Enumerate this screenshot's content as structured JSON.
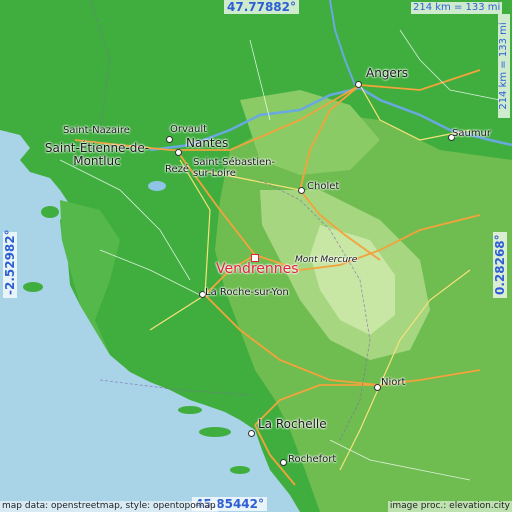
{
  "map": {
    "coordinates": {
      "top": "47.77882°",
      "bottom": "45.85442°",
      "left": "-2.52982°",
      "right": "0.28268°"
    },
    "scale": {
      "horizontal": "214 km = 133 mi",
      "vertical": "214 km = 133 mi"
    },
    "attribution": {
      "left": "map data: openstreetmap, style: opentopomap",
      "right": "image proc.: elevation.city"
    },
    "highlight_city": "Vendrennes",
    "cities": {
      "angers": "Angers",
      "saint_nazaire": "Saint-Nazaire",
      "orvault": "Orvault",
      "nantes": "Nantes",
      "saint_etienne_1": "Saint-Étienne-de-",
      "saint_etienne_2": "Montluc",
      "reze": "Rezé",
      "saint_sebastien_1": "Saint-Sébastien-",
      "saint_sebastien_2": "sur-Loire",
      "saumur": "Saumur",
      "cholet": "Cholet",
      "mont_mercure": "Mont Mercure",
      "la_roche_sur_yon": "La Roche-sur-Yon",
      "niort": "Niort",
      "la_rochelle": "La Rochelle",
      "rochefort": "Rochefort"
    },
    "colors": {
      "sea": "#a9d3e6",
      "lowland": "#3fae3e",
      "midland": "#7cc25a",
      "upland": "#bfe09a",
      "highlight": "#e0233c",
      "coord_text": "#2d5fd3"
    }
  }
}
